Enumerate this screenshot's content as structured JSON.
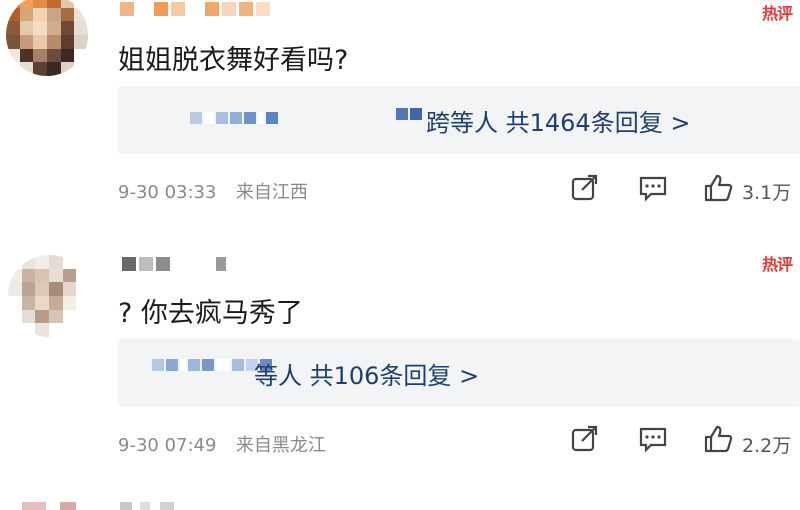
{
  "comments": [
    {
      "text": "姐姐脱衣舞好看吗?",
      "reply_text": "等人  共1464条回复 >",
      "reply_prefix_char": "跨",
      "time": "9-30 03:33",
      "location": "来自江西",
      "likes": "3.1万",
      "tag": "热评"
    },
    {
      "text": "? 你去疯马秀了",
      "reply_text": "等人  共106条回复 >",
      "reply_prefix_char": "",
      "time": "9-30 07:49",
      "location": "来自黑龙江",
      "likes": "2.2万",
      "tag": "热评"
    }
  ],
  "colors": {
    "link": "#1f3f74",
    "meta": "#8a8a8a",
    "reply_bg": "#f3f4f6",
    "tag": "#e23a3a"
  },
  "icons": [
    "share-icon",
    "comment-icon",
    "like-icon"
  ]
}
